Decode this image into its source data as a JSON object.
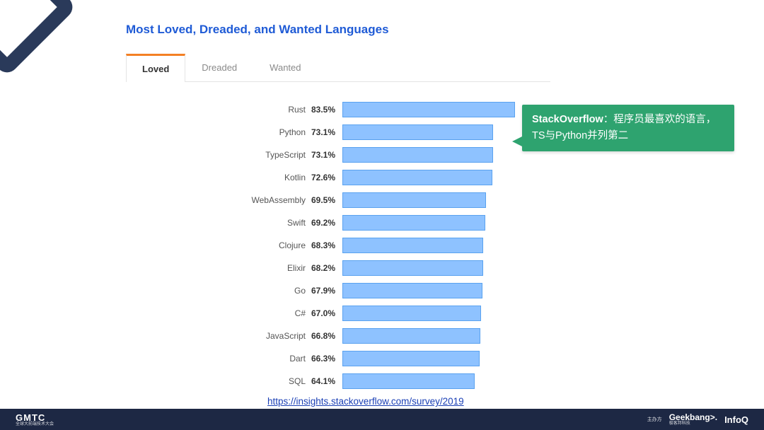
{
  "title": "Most Loved, Dreaded, and Wanted Languages",
  "tabs": [
    {
      "label": "Loved",
      "active": true
    },
    {
      "label": "Dreaded",
      "active": false
    },
    {
      "label": "Wanted",
      "active": false
    }
  ],
  "chart_data": {
    "type": "bar",
    "categories": [
      "Rust",
      "Python",
      "TypeScript",
      "Kotlin",
      "WebAssembly",
      "Swift",
      "Clojure",
      "Elixir",
      "Go",
      "C#",
      "JavaScript",
      "Dart",
      "SQL"
    ],
    "values": [
      83.5,
      73.1,
      73.1,
      72.6,
      69.5,
      69.2,
      68.3,
      68.2,
      67.9,
      67.0,
      66.8,
      66.3,
      64.1
    ],
    "value_labels": [
      "83.5%",
      "73.1%",
      "73.1%",
      "72.6%",
      "69.5%",
      "69.2%",
      "68.3%",
      "68.2%",
      "67.9%",
      "67.0%",
      "66.8%",
      "66.3%",
      "64.1%"
    ],
    "xlabel": "",
    "ylabel": "",
    "xlim": [
      0,
      100
    ]
  },
  "callout": {
    "bold": "StackOverflow",
    "rest": "：程序员最喜欢的语言，TS与Python并列第二"
  },
  "source_link": "https://insights.stackoverflow.com/survey/2019",
  "footer": {
    "left_main": "GMTC",
    "left_sub": "全球大前端技术大会",
    "host_label": "主办方",
    "brand1": "Geekbang>.",
    "brand1_sub": "极客邦科技",
    "brand2": "InfoQ"
  }
}
